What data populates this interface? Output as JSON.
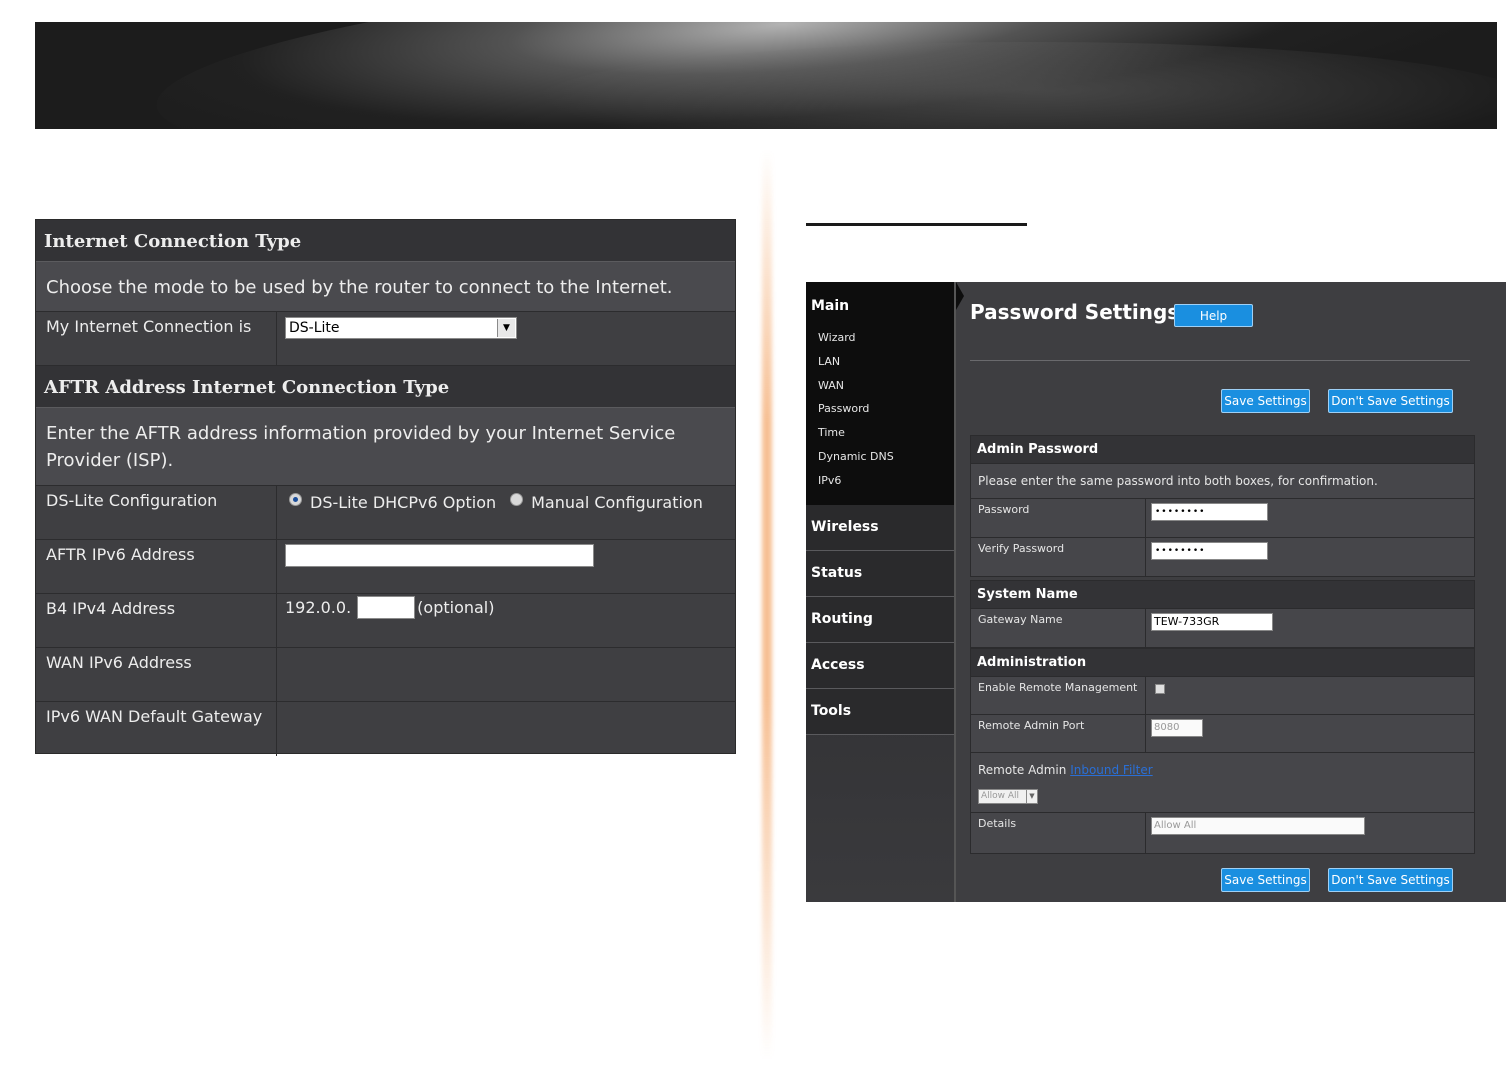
{
  "left": {
    "header1": "Internet Connection Type",
    "desc1": "Choose the mode to be used by the router to connect to the Internet.",
    "connection_label": "My Internet Connection is",
    "connection_value": "DS-Lite",
    "header2": "AFTR Address Internet Connection Type",
    "desc2": "Enter the AFTR address information provided by your Internet Service Provider (ISP).",
    "dslite_label": "DS-Lite Configuration",
    "option1": "DS-Lite DHCPv6 Option",
    "option2": "Manual Configuration",
    "aftr_label": "AFTR IPv6 Address",
    "b4_label": "B4 IPv4 Address",
    "b4_prefix": "192.0.0.",
    "b4_optional": "(optional)",
    "wan_label": "WAN IPv6 Address",
    "gateway_label": "IPv6 WAN Default Gateway"
  },
  "sidebar": {
    "main": "Main",
    "items": [
      "Wizard",
      "LAN",
      "WAN",
      "Password",
      "Time",
      "Dynamic DNS",
      "IPv6"
    ],
    "categories": [
      "Wireless",
      "Status",
      "Routing",
      "Access",
      "Tools"
    ]
  },
  "content": {
    "title": "Password Settings",
    "help": "Help",
    "save": "Save Settings",
    "dont_save": "Don't Save Settings",
    "admin_header": "Admin Password",
    "admin_note": "Please enter the same password into both boxes, for confirmation.",
    "password_label": "Password",
    "password_value": "••••••••",
    "verify_label": "Verify Password",
    "verify_value": "••••••••",
    "system_header": "System Name",
    "gateway_name_label": "Gateway Name",
    "gateway_name_value": "TEW-733GR",
    "admin_section": "Administration",
    "remote_mgmt_label": "Enable Remote Management",
    "remote_port_label": "Remote Admin Port",
    "remote_port_value": "8080",
    "remote_admin_text": "Remote Admin",
    "inbound_filter": "Inbound Filter",
    "allow_all": "Allow All",
    "details_label": "Details",
    "details_value": "Allow All"
  }
}
